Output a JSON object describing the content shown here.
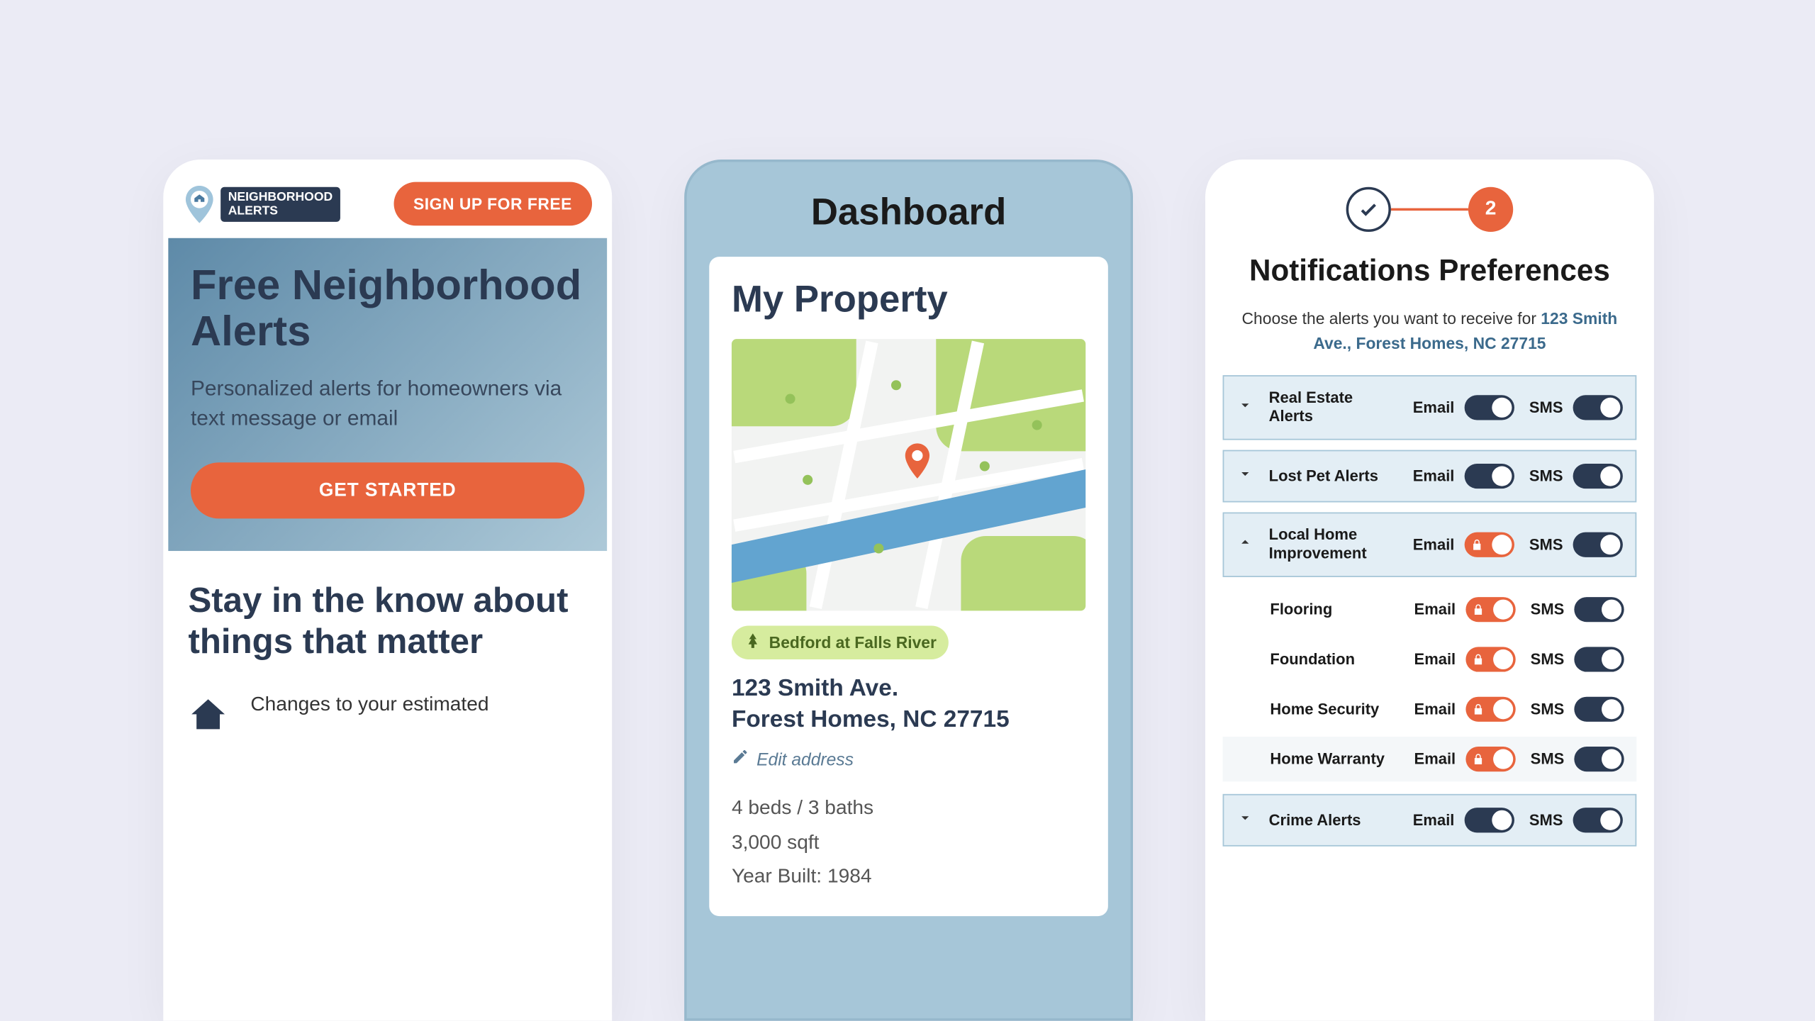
{
  "phone1": {
    "logo_line1": "NEIGHBORHOOD",
    "logo_line2": "ALERTS",
    "signup": "SIGN UP FOR FREE",
    "hero_title": "Free Neighborhood Alerts",
    "hero_sub": "Personalized alerts for homeowners via text message or email",
    "cta": "GET STARTED",
    "section_title": "Stay in the know about things that matter",
    "feature1": "Changes to your estimated"
  },
  "phone2": {
    "title": "Dashboard",
    "card_title": "My Property",
    "location_chip": "Bedford at Falls River",
    "address_line1": "123 Smith Ave.",
    "address_line2": "Forest Homes, NC 27715",
    "edit": "Edit address",
    "spec_beds": "4 beds / 3 baths",
    "spec_sqft": "3,000 sqft",
    "spec_year": "Year Built: 1984"
  },
  "phone3": {
    "step2": "2",
    "title": "Notifications Preferences",
    "sub_pre": "Choose the alerts you want to receive for ",
    "sub_addr": "123 Smith Ave., Forest Homes, NC 27715",
    "labels": {
      "email": "Email",
      "sms": "SMS"
    },
    "rows": [
      {
        "name": "Real Estate Alerts"
      },
      {
        "name": "Lost Pet Alerts"
      },
      {
        "name": "Local Home Improvement"
      },
      {
        "name": "Flooring"
      },
      {
        "name": "Foundation"
      },
      {
        "name": "Home Security"
      },
      {
        "name": "Home Warranty"
      },
      {
        "name": "Crime Alerts"
      }
    ]
  }
}
